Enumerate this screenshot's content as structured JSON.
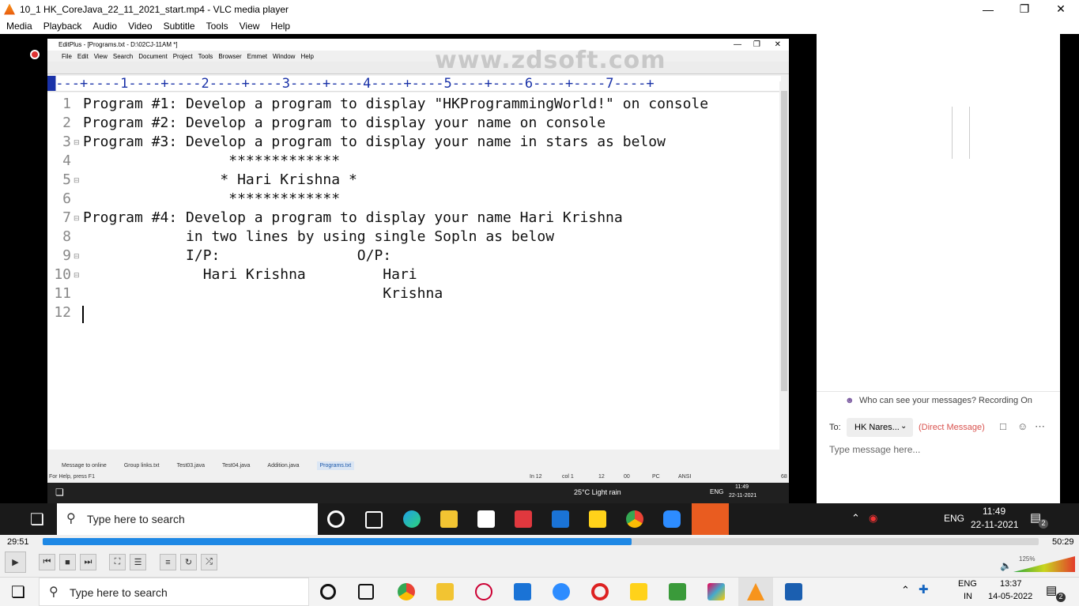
{
  "vlc": {
    "title": "10_1 HK_CoreJava_22_11_2021_start.mp4 - VLC media player",
    "menu": [
      "Media",
      "Playback",
      "Audio",
      "Video",
      "Subtitle",
      "Tools",
      "View",
      "Help"
    ],
    "time_elapsed": "29:51",
    "time_total": "50:29",
    "progress": 0.591,
    "volume_label": "125%"
  },
  "editplus": {
    "title": "EditPlus - [Programs.txt - D:\\02CJ-11AM *]",
    "menu": [
      "File",
      "Edit",
      "View",
      "Search",
      "Document",
      "Project",
      "Tools",
      "Browser",
      "Emmet",
      "Window",
      "Help"
    ],
    "watermark": "www.zdsoft.com",
    "ruler": "█---+----1----+----2----+----3----+----4----+----5----+----6----+----7----+",
    "lines": [
      {
        "n": "1",
        "text": "Program #1: Develop a program to display \"HKProgrammingWorld!\" on console"
      },
      {
        "n": "2",
        "text": "Program #2: Develop a program to display your name on console"
      },
      {
        "n": "3",
        "text": "Program #3: Develop a program to display your name in stars as below"
      },
      {
        "n": "4",
        "text": "                 *************"
      },
      {
        "n": "5",
        "text": "                * Hari Krishna *"
      },
      {
        "n": "6",
        "text": "                 *************"
      },
      {
        "n": "7",
        "text": "Program #4: Develop a program to display your name Hari Krishna"
      },
      {
        "n": "8",
        "text": "            in two lines by using single Sopln as below"
      },
      {
        "n": "9",
        "text": "            I/P:                O/P:"
      },
      {
        "n": "10",
        "text": "              Hari Krishna         Hari"
      },
      {
        "n": "11",
        "text": "                                   Krishna"
      },
      {
        "n": "12",
        "text": ""
      }
    ],
    "tabs": [
      "Message to online",
      "Group links.txt",
      "Test03.java",
      "Test04.java",
      "Addition.java",
      "Programs.txt"
    ],
    "active_tab": "Programs.txt",
    "status": {
      "help": "For Help, press F1",
      "line": "In 12",
      "col": "col 1",
      "n1": "12",
      "n2": "00",
      "mode": "PC",
      "enc": "ANSI",
      "n3": "68"
    }
  },
  "inner_taskbar": {
    "weather": "25°C  Light rain",
    "lang": "ENG",
    "time": "11:49",
    "date": "22-11-2021"
  },
  "chat": {
    "recording_note": "Who can see your messages? Recording On",
    "to_label": "To:",
    "recipient": "HK Nares...",
    "direct": "(Direct Message)",
    "placeholder": "Type message here..."
  },
  "video_taskbar": {
    "search_placeholder": "Type here to search",
    "lang": "ENG",
    "time": "11:49",
    "date": "22-11-2021",
    "notif": "2"
  },
  "os_taskbar": {
    "search_placeholder": "Type here to search",
    "lang1": "ENG",
    "lang2": "IN",
    "time": "13:37",
    "date": "14-05-2022",
    "notif": "2"
  }
}
